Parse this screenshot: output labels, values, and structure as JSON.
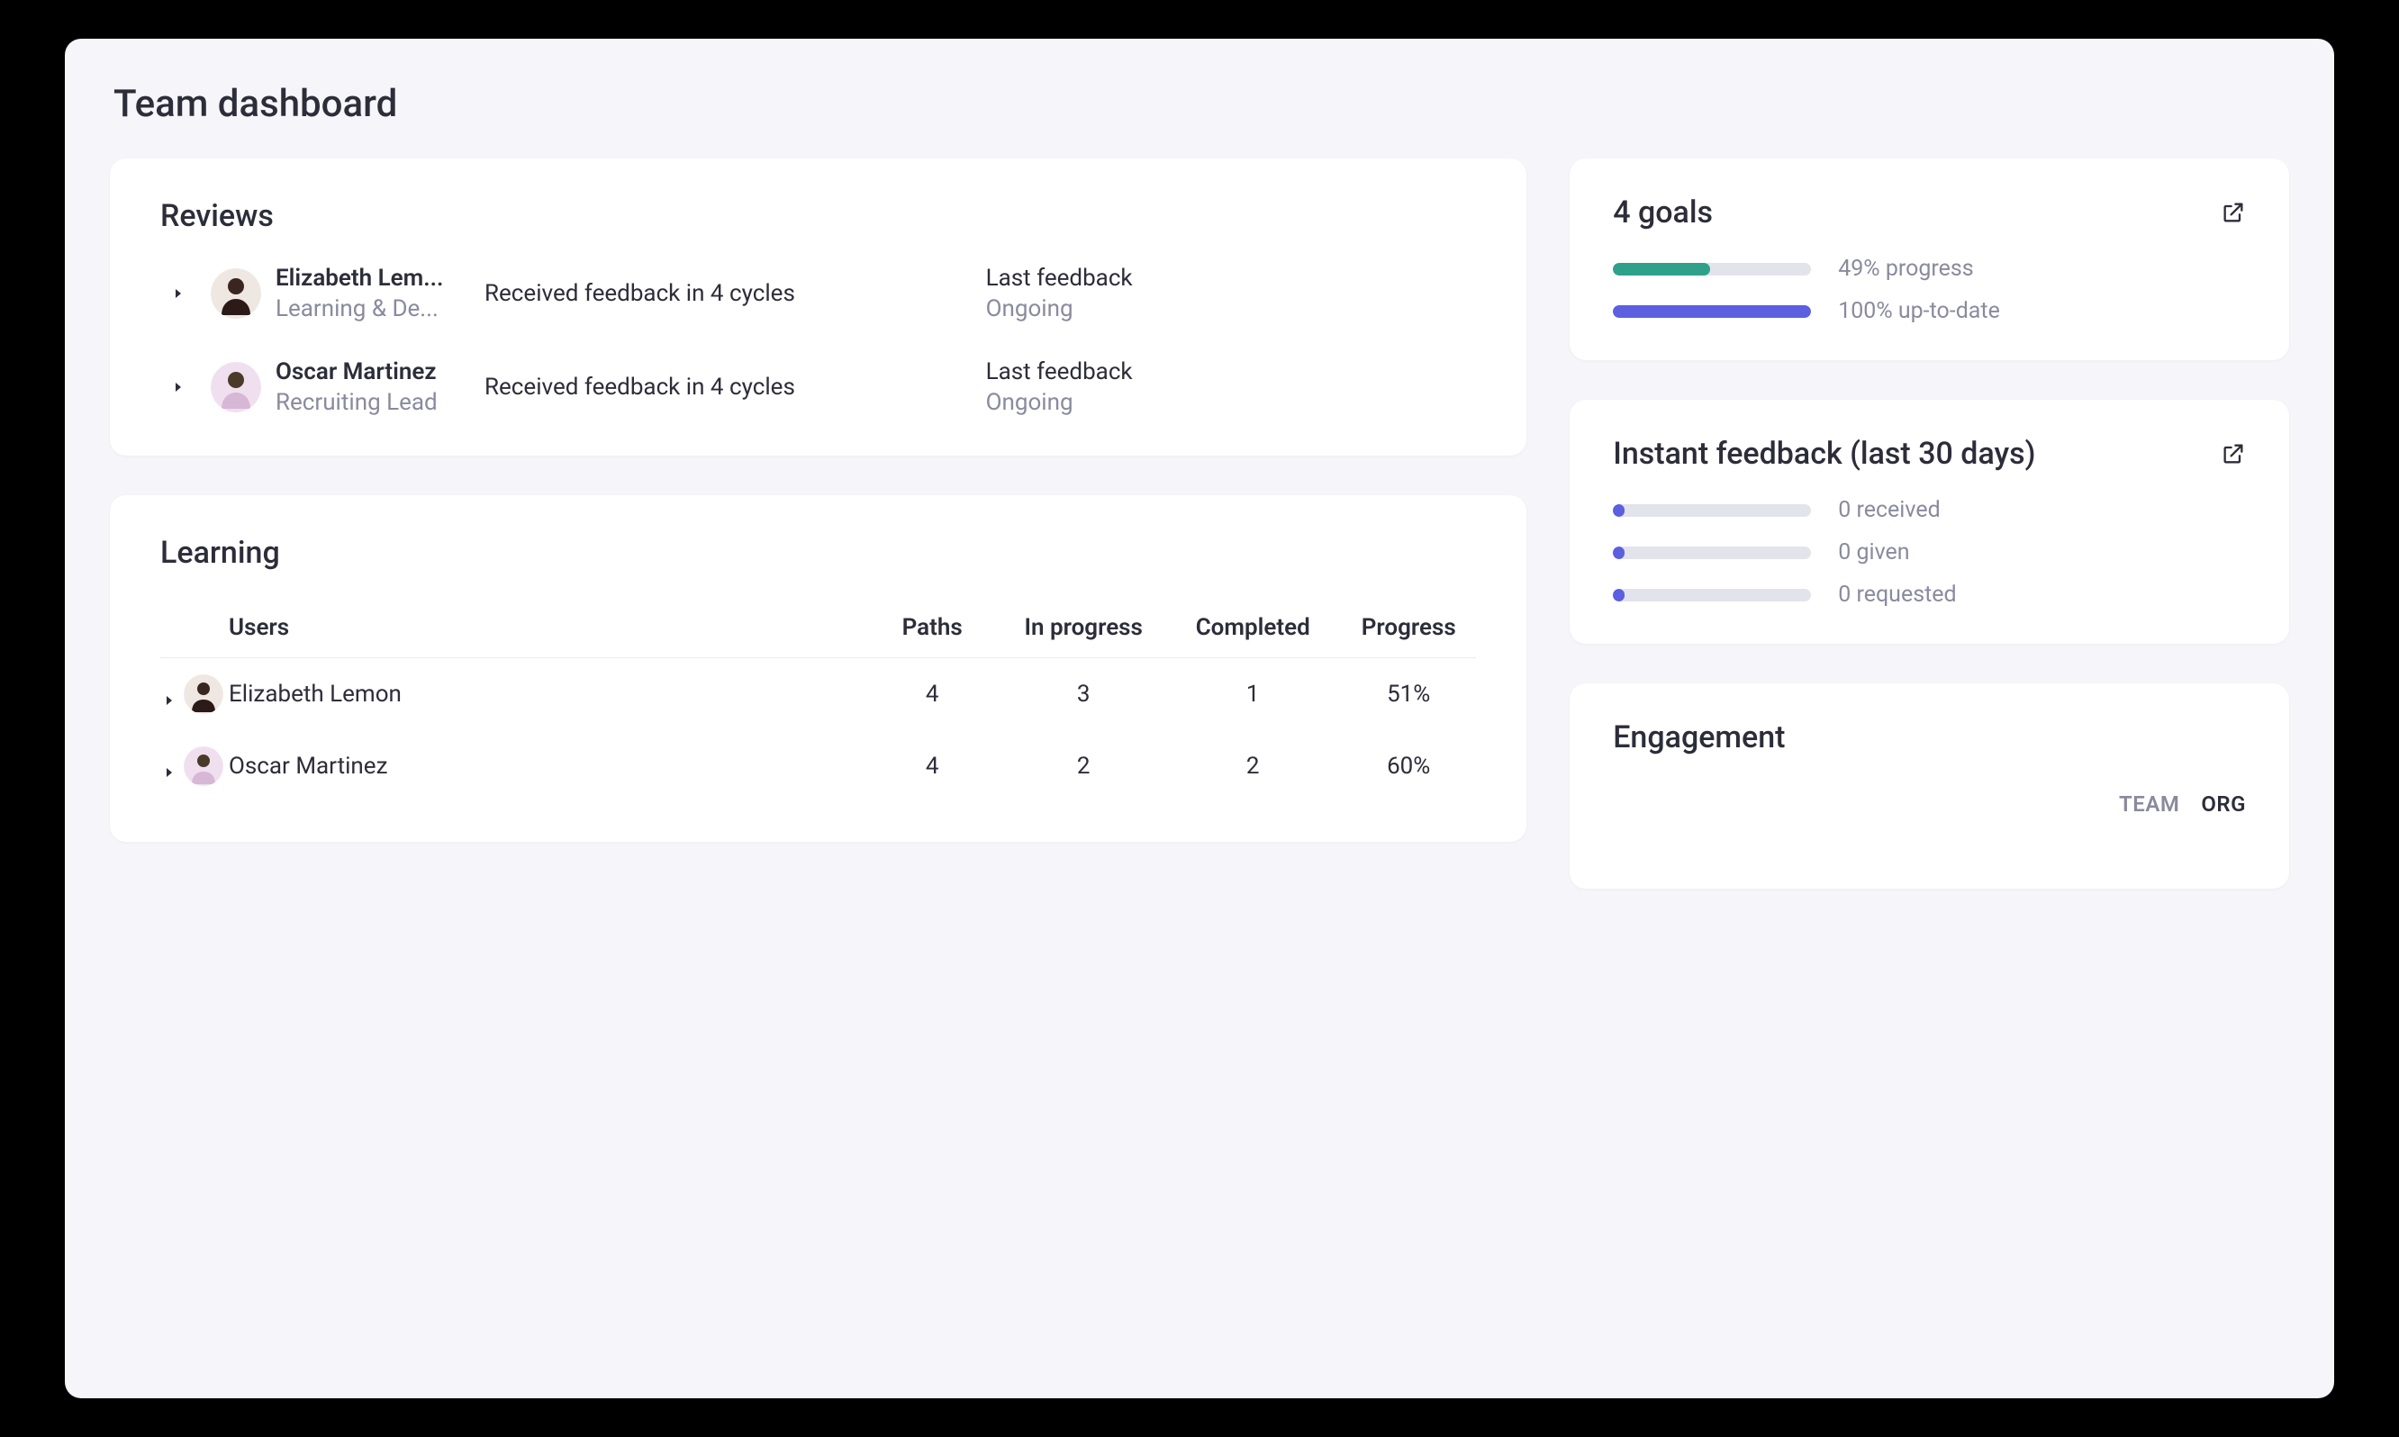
{
  "page_title": "Team dashboard",
  "reviews": {
    "title": "Reviews",
    "rows": [
      {
        "name": "Elizabeth Lem...",
        "role": "Learning & De...",
        "feedback_text": "Received feedback in 4 cycles",
        "last_label": "Last feedback",
        "last_value": "Ongoing",
        "avatar_color": "#2b1a18"
      },
      {
        "name": "Oscar Martinez",
        "role": "Recruiting Lead",
        "feedback_text": "Received feedback in 4 cycles",
        "last_label": "Last feedback",
        "last_value": "Ongoing",
        "avatar_color": "#d7b7d6"
      }
    ]
  },
  "learning": {
    "title": "Learning",
    "headers": {
      "users": "Users",
      "paths": "Paths",
      "in_progress": "In progress",
      "completed": "Completed",
      "progress": "Progress"
    },
    "rows": [
      {
        "name": "Elizabeth Lemon",
        "paths": "4",
        "in_progress": "3",
        "completed": "1",
        "progress": "51%",
        "avatar_color": "#2b1a18"
      },
      {
        "name": "Oscar Martinez",
        "paths": "4",
        "in_progress": "2",
        "completed": "2",
        "progress": "60%",
        "avatar_color": "#d7b7d6"
      }
    ]
  },
  "goals": {
    "title": "4 goals",
    "metrics": [
      {
        "pct": 49,
        "label": "49% progress",
        "color": "#2fa08a"
      },
      {
        "pct": 100,
        "label": "100% up-to-date",
        "color": "#5b5fe0"
      }
    ]
  },
  "instant_feedback": {
    "title": "Instant feedback (last 30 days)",
    "metrics": [
      {
        "pct": 6,
        "label": "0 received",
        "color": "#5b5fe0"
      },
      {
        "pct": 6,
        "label": "0 given",
        "color": "#5b5fe0"
      },
      {
        "pct": 6,
        "label": "0 requested",
        "color": "#5b5fe0"
      }
    ]
  },
  "engagement": {
    "title": "Engagement",
    "tabs": {
      "team": "TEAM",
      "org": "ORG"
    }
  },
  "chart_data": [
    {
      "type": "bar",
      "title": "4 goals",
      "series": [
        {
          "name": "progress",
          "values": [
            49
          ]
        },
        {
          "name": "up-to-date",
          "values": [
            100
          ]
        }
      ],
      "ylim": [
        0,
        100
      ]
    },
    {
      "type": "bar",
      "title": "Instant feedback (last 30 days)",
      "categories": [
        "received",
        "given",
        "requested"
      ],
      "values": [
        0,
        0,
        0
      ]
    }
  ]
}
